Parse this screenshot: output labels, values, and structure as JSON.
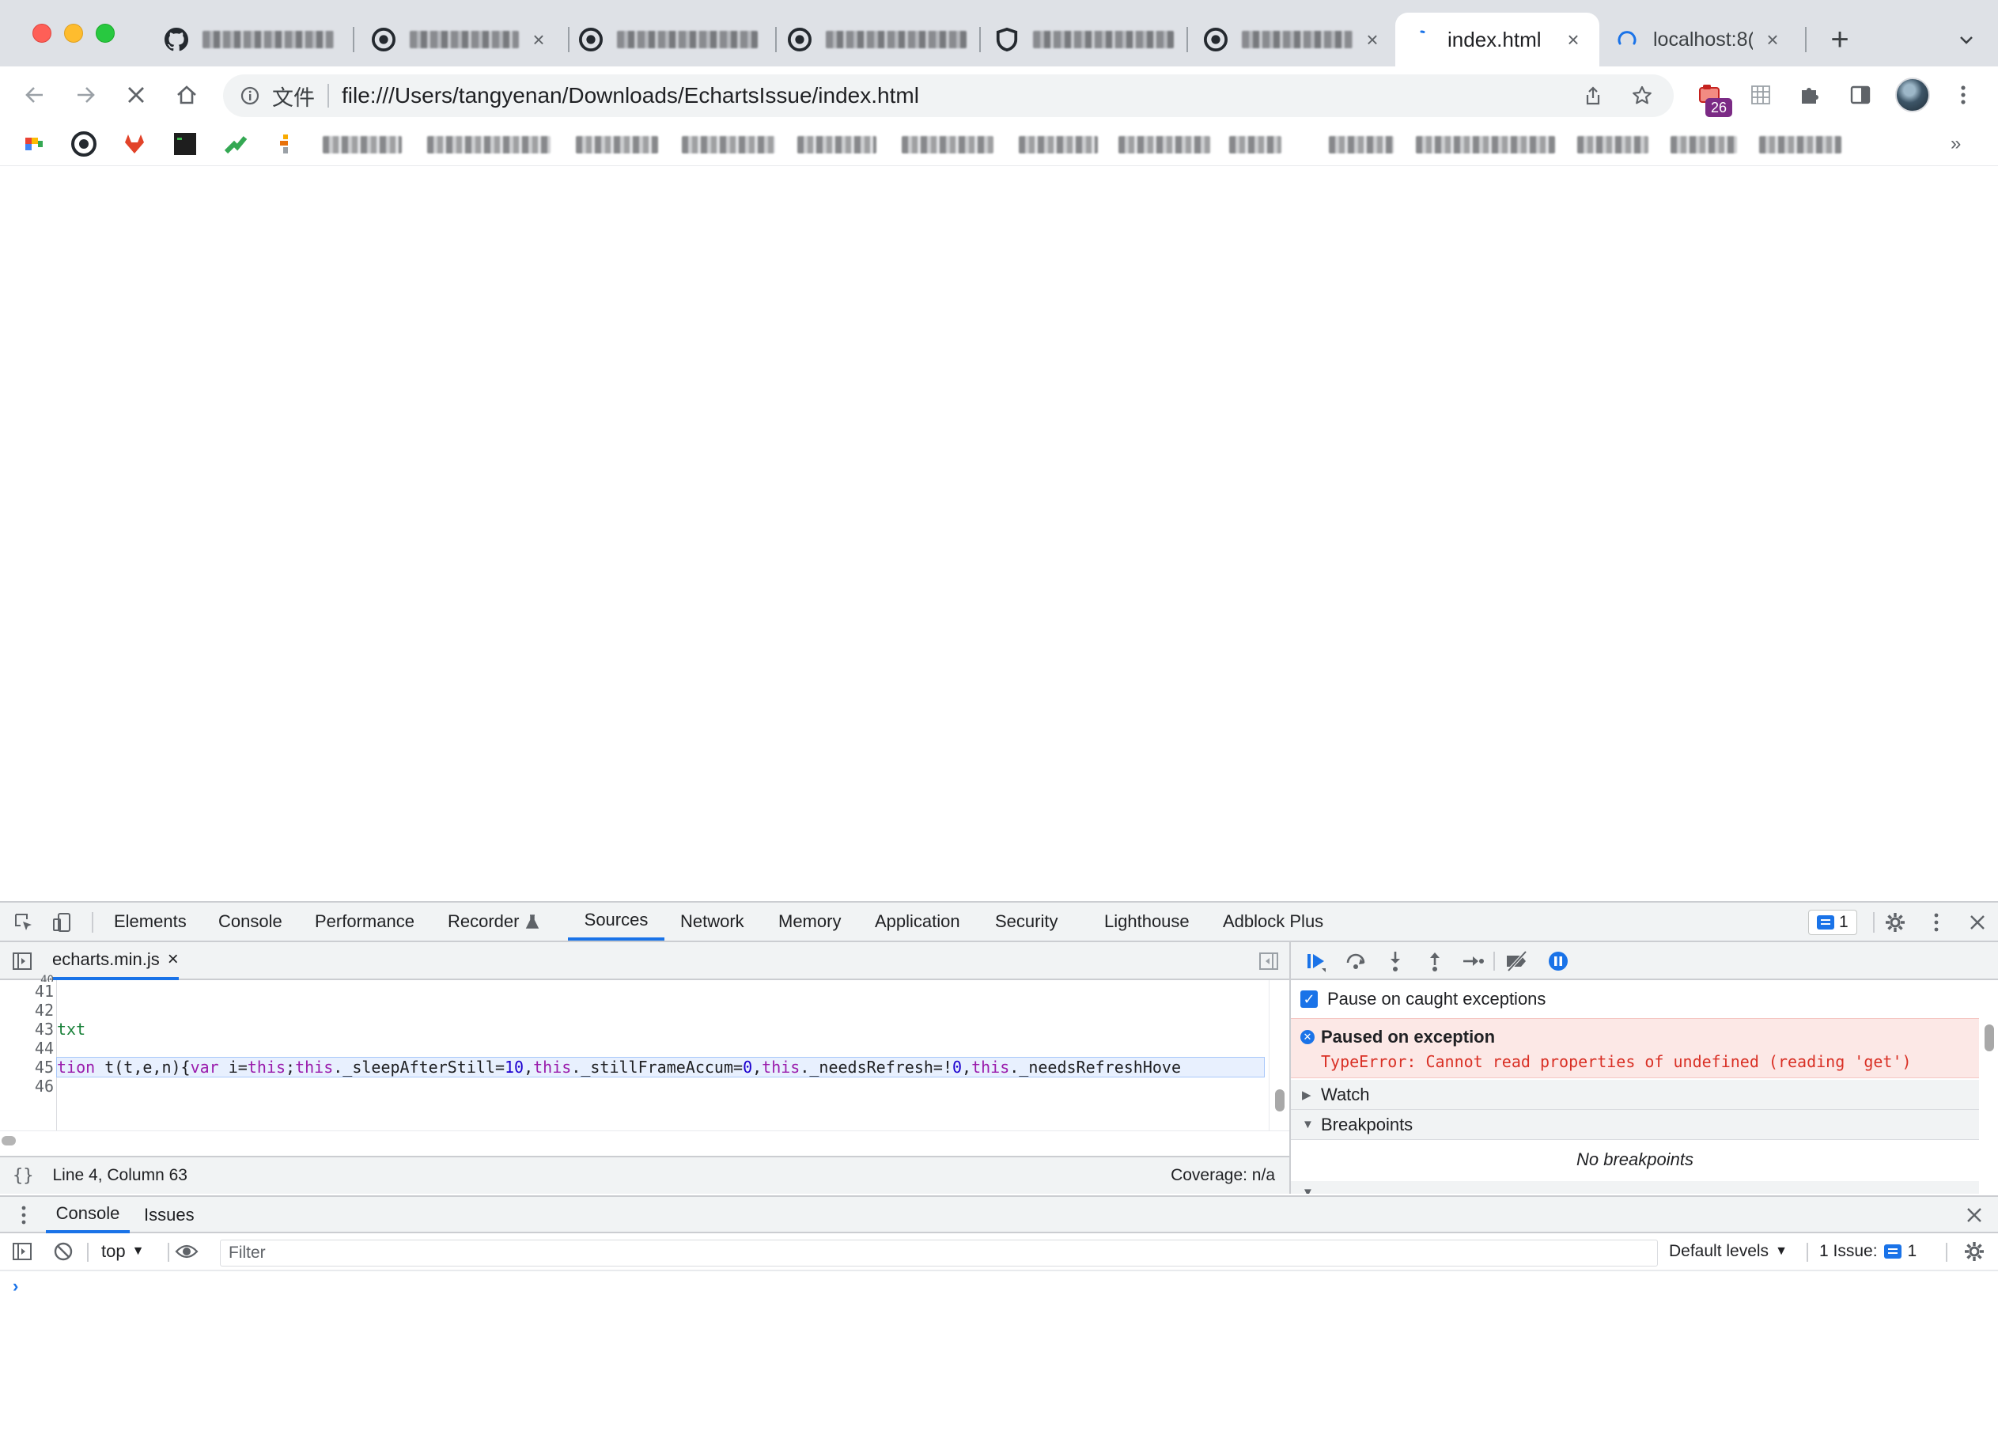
{
  "browser": {
    "tabs": [
      {
        "title": "",
        "blurred": true
      },
      {
        "title": "",
        "blurred": true
      },
      {
        "title": "",
        "blurred": true
      },
      {
        "title": "",
        "blurred": true
      },
      {
        "title": "",
        "blurred": true
      },
      {
        "title": "",
        "blurred": true
      },
      {
        "title": "index.html",
        "active": true,
        "loading": true
      },
      {
        "title": "localhost:8(",
        "loading": true
      }
    ],
    "address": {
      "chip": "文件",
      "url": "file:///Users/tangyenan/Downloads/EchartsIssue/index.html"
    },
    "extension_badge": "26"
  },
  "devtools": {
    "tabs": [
      "Elements",
      "Console",
      "Performance",
      "Recorder",
      "Sources",
      "Network",
      "Memory",
      "Application",
      "Security",
      "Lighthouse",
      "Adblock Plus"
    ],
    "active_tab": "Sources",
    "issues_count": "1",
    "sources": {
      "open_file": "echarts.min.js",
      "lines": [
        {
          "num": "41",
          "text": ""
        },
        {
          "num": "42",
          "text": ""
        },
        {
          "num": "43",
          "text": "txt"
        },
        {
          "num": "44",
          "text": ""
        },
        {
          "num": "45",
          "text": "tion t(t,e,n){var i=this;this._sleepAfterStill=10,this._stillFrameAccum=0,this._needsRefresh=!0,this._needsRefreshHove"
        },
        {
          "num": "46",
          "text": ""
        }
      ],
      "cursor_position": "Line 4, Column 63",
      "coverage": "Coverage: n/a"
    },
    "debugger": {
      "pause_on_caught_label": "Pause on caught exceptions",
      "pause_on_caught_checked": true,
      "paused_title": "Paused on exception",
      "paused_message": "TypeError: Cannot read properties of undefined (reading 'get')",
      "sections": {
        "watch": "Watch",
        "breakpoints": "Breakpoints",
        "no_breakpoints": "No breakpoints"
      }
    },
    "drawer": {
      "tabs": [
        "Console",
        "Issues"
      ],
      "active_tab": "Console",
      "context": "top",
      "filter_placeholder": "Filter",
      "levels": "Default levels",
      "issue_label": "1 Issue:",
      "issue_count": "1",
      "prompt": "›"
    }
  },
  "colors": {
    "accent": "#1a73e8",
    "error_text": "#d93025",
    "exception_bg": "#fce8e6"
  }
}
